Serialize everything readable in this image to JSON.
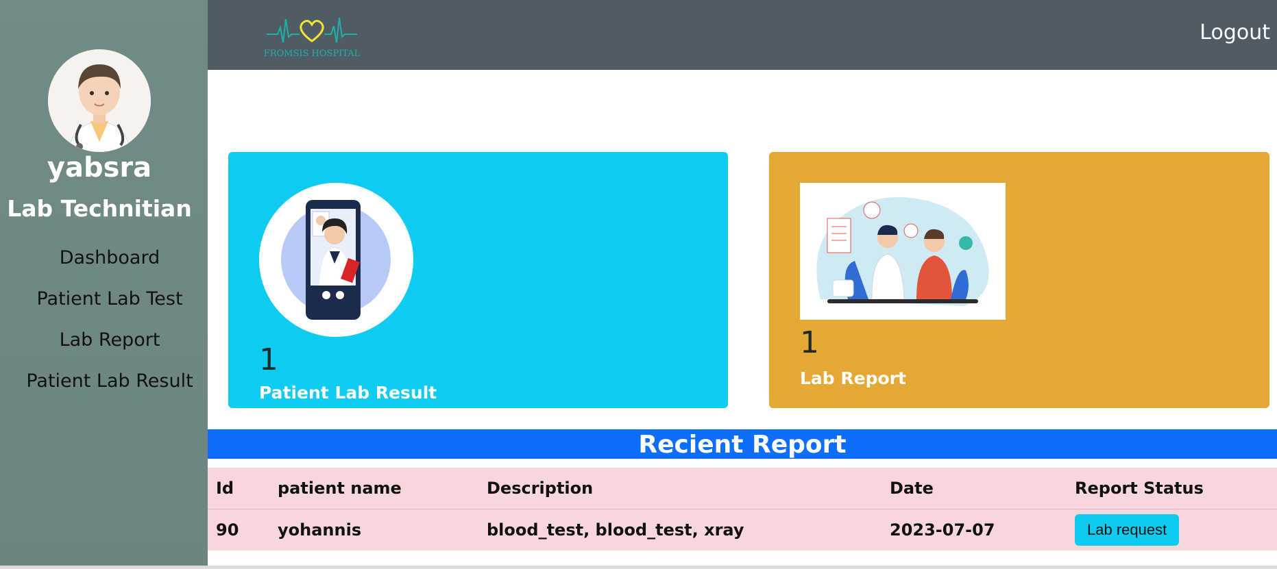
{
  "brand": {
    "logo_text": "FROMSIS HOSPITAL"
  },
  "header": {
    "logout_label": "Logout"
  },
  "user": {
    "name": "yabsra",
    "role": "Lab Technitian"
  },
  "sidebar": {
    "items": [
      {
        "label": "Dashboard"
      },
      {
        "label": "Patient Lab Test"
      },
      {
        "label": "Lab Report"
      },
      {
        "label": "Patient Lab Result"
      }
    ]
  },
  "cards": [
    {
      "count": "1",
      "label": "Patient Lab Result",
      "color": "#0ecbef"
    },
    {
      "count": "1",
      "label": "Lab Report",
      "color": "#e6a834"
    }
  ],
  "report": {
    "title": "Recient Report",
    "columns": [
      "Id",
      "patient name",
      "Description",
      "Date",
      "Report Status"
    ],
    "rows": [
      {
        "id": "90",
        "patient_name": "yohannis",
        "description": "blood_test, blood_test, xray",
        "date": "2023-07-07",
        "status": "Lab request"
      }
    ]
  },
  "colors": {
    "sidebar": "#738b86",
    "topbar": "#4f5c66",
    "banner": "#0d6efd",
    "table_bg": "#f8d7dc",
    "status_button": "#0dcaf0"
  }
}
